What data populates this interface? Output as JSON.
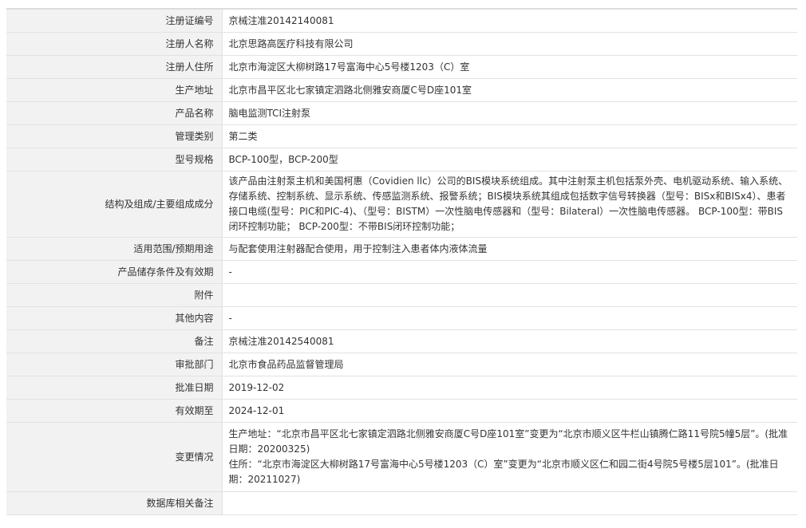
{
  "rows": [
    {
      "label": "注册证编号",
      "value": "京械注准20142140081"
    },
    {
      "label": "注册人名称",
      "value": "北京思路高医疗科技有限公司"
    },
    {
      "label": "注册人住所",
      "value": "北京市海淀区大柳树路17号富海中心5号楼1203（C）室"
    },
    {
      "label": "生产地址",
      "value": "北京市昌平区北七家镇定泗路北侧雅安商厦C号D座101室"
    },
    {
      "label": "产品名称",
      "value": "脑电监测TCI注射泵"
    },
    {
      "label": "管理类别",
      "value": "第二类"
    },
    {
      "label": "型号规格",
      "value": "BCP-100型，BCP-200型"
    },
    {
      "label": "结构及组成/主要组成成分",
      "value": "该产品由注射泵主机和美国柯惠（Covidien llc）公司的BIS模块系统组成。其中注射泵主机包括泵外壳、电机驱动系统、输入系统、存储系统、控制系统、显示系统、传感监测系统、报警系统；BIS模块系统其组成包括数字信号转换器（型号：BISx和BISx4）、患者接口电缆(型号：PIC和PIC-4)、（型号：BISTM）一次性脑电传感器和（型号：Bilateral）一次性脑电传感器。 BCP-100型：带BIS闭环控制功能； BCP-200型：不带BIS闭环控制功能；"
    },
    {
      "label": "适用范围/预期用途",
      "value": "与配套使用注射器配合使用，用于控制注入患者体内液体流量"
    },
    {
      "label": "产品储存条件及有效期",
      "value": "-"
    },
    {
      "label": "附件",
      "value": ""
    },
    {
      "label": "其他内容",
      "value": "-"
    },
    {
      "label": "备注",
      "value": "京械注准20142540081"
    },
    {
      "label": "审批部门",
      "value": "北京市食品药品监督管理局"
    },
    {
      "label": "批准日期",
      "value": "2019-12-02"
    },
    {
      "label": "有效期至",
      "value": "2024-12-01"
    },
    {
      "label": "变更情况",
      "value_lines": [
        "生产地址：“北京市昌平区北七家镇定泗路北侧雅安商厦C号D座101室”变更为“北京市顺义区牛栏山镇腾仁路11号院5幢5层”。(批准日期：20200325)",
        "住所：“北京市海淀区大柳树路17号富海中心5号楼1203（C）室”变更为“北京市顺义区仁和园二街4号院5号楼5层101”。(批准日期：20211027)"
      ]
    },
    {
      "label": "数据库相关备注",
      "value": ""
    }
  ]
}
